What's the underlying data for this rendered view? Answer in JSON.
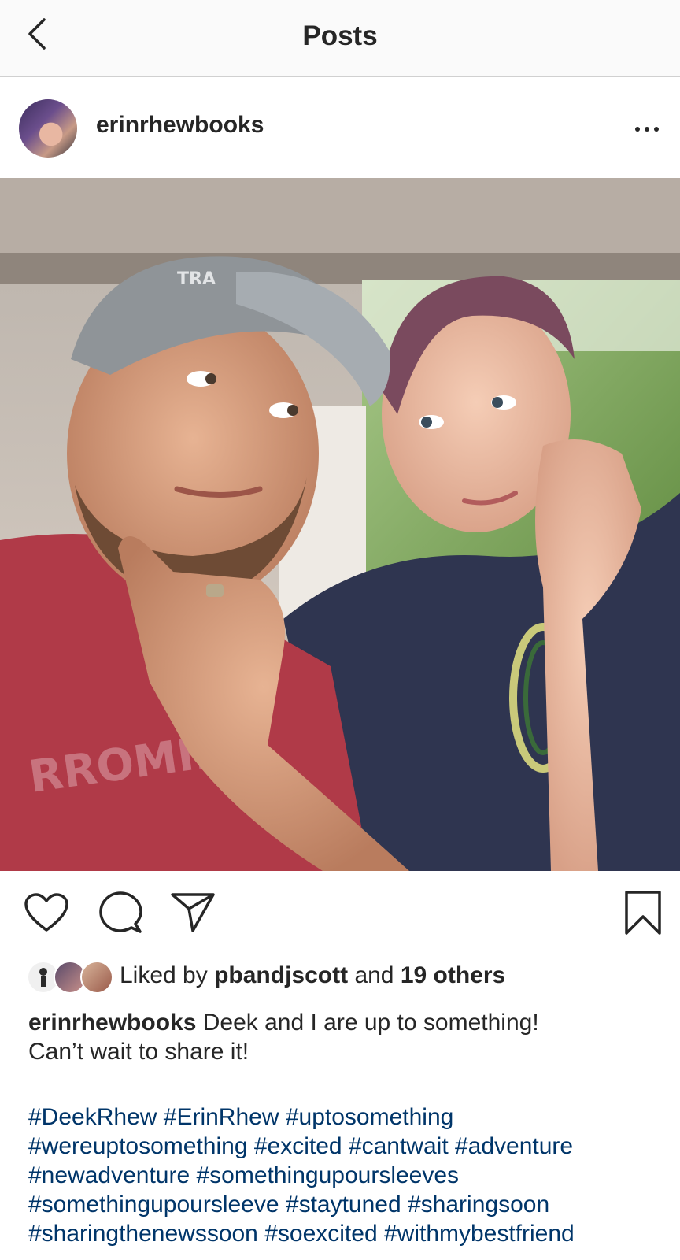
{
  "nav": {
    "title": "Posts",
    "back_icon": "chevron-left-icon"
  },
  "post": {
    "username": "erinrhewbooks",
    "more_icon": "more-horizontal-icon",
    "photo_shirt_text_1": "TRA",
    "photo_shirt_text_2": "RROMIE A"
  },
  "actions": {
    "like_icon": "heart-icon",
    "comment_icon": "comment-icon",
    "share_icon": "send-icon",
    "save_icon": "bookmark-icon"
  },
  "likes": {
    "prefix": "Liked by",
    "liker": "pbandjscott",
    "middle": "and",
    "others": "19 others"
  },
  "caption": {
    "username": "erinrhewbooks",
    "line1": "Deek and I are up to something!",
    "line2": "Can’t wait to share it!"
  },
  "hashtags": [
    "#DeekRhew #ErinRhew #uptosomething",
    "#wereuptosomething #excited #cantwait #adventure",
    "#newadventure #somethingupoursleeves",
    "#somethingupoursleeve #staytuned #sharingsoon",
    "#sharingthenewssoon #soexcited #withmybestfriend"
  ],
  "colors": {
    "text": "#262626",
    "hashtag": "#003569",
    "nav_bg": "#fafafa",
    "divider": "#d0d0d0"
  }
}
